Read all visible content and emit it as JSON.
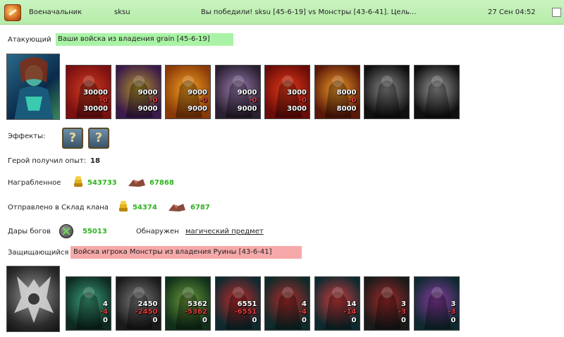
{
  "header": {
    "sender": "Военачальник",
    "recipient": "sksu",
    "subject": "Вы победили! sksu [45-6-19] vs Монстры [43-6-41]. Цель...",
    "date": "27 Сен 04:52"
  },
  "attacker": {
    "label": "Атакующий",
    "troops_text": "Ваши войска из владения grain [45-6-19]",
    "units": [
      {
        "icon": "demon-unit-icon",
        "count": "30000",
        "loss": "-0",
        "left": "30000",
        "colors": [
          "#7a1010",
          "#d03a20"
        ]
      },
      {
        "icon": "skeleton-unit-icon",
        "count": "9000",
        "loss": "-0",
        "left": "9000",
        "colors": [
          "#3a1a4a",
          "#b0902a"
        ]
      },
      {
        "icon": "fire-beast-unit-icon",
        "count": "9000",
        "loss": "-0",
        "left": "9000",
        "colors": [
          "#8a3a08",
          "#f4a020"
        ]
      },
      {
        "icon": "gargoyle-unit-icon",
        "count": "9000",
        "loss": "-0",
        "left": "9000",
        "colors": [
          "#2a2030",
          "#9a7ab0"
        ]
      },
      {
        "icon": "fire-giant-unit-icon",
        "count": "3000",
        "loss": "-0",
        "left": "3000",
        "colors": [
          "#6a0c08",
          "#e83a18"
        ]
      },
      {
        "icon": "pit-lord-unit-icon",
        "count": "8000",
        "loss": "-0",
        "left": "8000",
        "colors": [
          "#5a1808",
          "#f09a28"
        ]
      },
      {
        "icon": "dark-knight-unit-icon",
        "count": "",
        "loss": "",
        "left": "",
        "colors": [
          "#101010",
          "#8a8a8a"
        ]
      },
      {
        "icon": "reaper-unit-icon",
        "count": "",
        "loss": "",
        "left": "",
        "colors": [
          "#101010",
          "#9a9a9a"
        ]
      }
    ]
  },
  "effects": {
    "label": "Эффекты:",
    "items": [
      "?",
      "?"
    ]
  },
  "hero_exp": {
    "label": "Герой получил опыт:",
    "value": "18"
  },
  "loot": {
    "label": "Награбленное",
    "gold": "543733",
    "ore": "67868"
  },
  "clan": {
    "label": "Отправлено в Склад клана",
    "gold": "54374",
    "ore": "6787"
  },
  "gifts": {
    "label": "Дары богов",
    "value": "55013",
    "found_label": "Обнаружен",
    "found_link": "магический предмет"
  },
  "defender": {
    "label": "Защищающийся",
    "troops_text": "Войска игрока Монстры из владения Руины [43-6-41]",
    "units": [
      {
        "icon": "lizard-warrior-unit-icon",
        "count": "4",
        "loss": "-4",
        "left": "0",
        "colors": [
          "#0e2a22",
          "#3aa07a"
        ]
      },
      {
        "icon": "stone-golem-unit-icon",
        "count": "2450",
        "loss": "-2450",
        "left": "0",
        "colors": [
          "#1a1a1a",
          "#7a7a7a"
        ]
      },
      {
        "icon": "orc-warrior-unit-icon",
        "count": "5362",
        "loss": "-5362",
        "left": "0",
        "colors": [
          "#10301a",
          "#6a9a3a"
        ]
      },
      {
        "icon": "red-demon-unit-icon",
        "count": "6551",
        "loss": "-6551",
        "left": "0",
        "colors": [
          "#0e2a30",
          "#c02a2a"
        ]
      },
      {
        "icon": "spiked-beast-unit-icon",
        "count": "4",
        "loss": "-4",
        "left": "0",
        "colors": [
          "#0e2a2a",
          "#b02a2a"
        ]
      },
      {
        "icon": "red-dragon-unit-icon",
        "count": "14",
        "loss": "-14",
        "left": "0",
        "colors": [
          "#0e2a30",
          "#d03a3a"
        ]
      },
      {
        "icon": "crimson-tower-unit-icon",
        "count": "3",
        "loss": "-3",
        "left": "0",
        "colors": [
          "#1a1a1a",
          "#a02a2a"
        ]
      },
      {
        "icon": "naga-unit-icon",
        "count": "3",
        "loss": "-3",
        "left": "0",
        "colors": [
          "#0e2a30",
          "#8a3aa0"
        ]
      }
    ]
  }
}
